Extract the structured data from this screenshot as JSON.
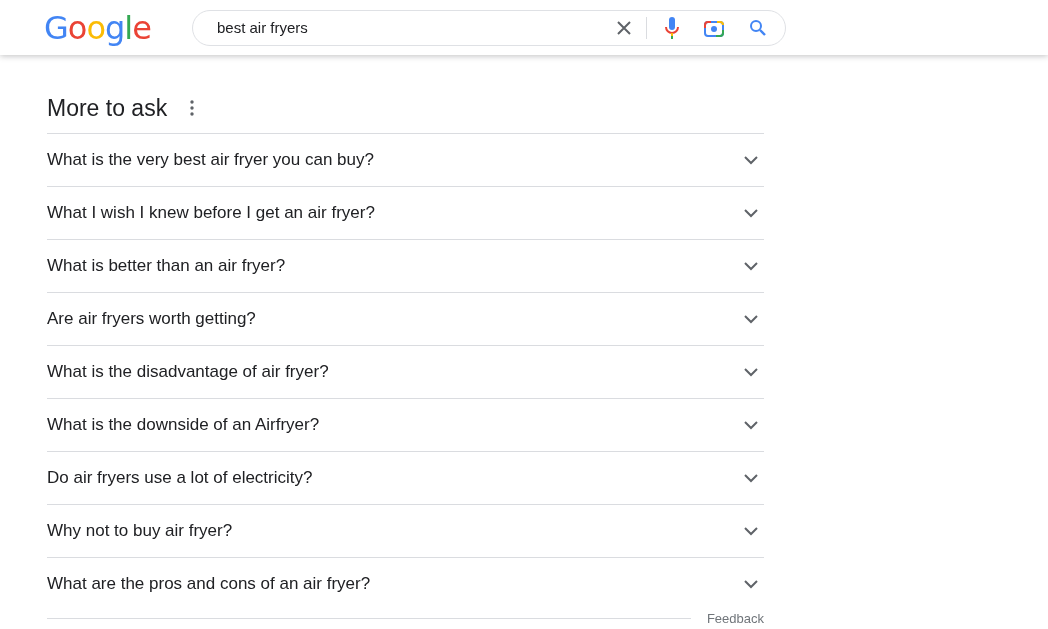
{
  "header": {
    "logo": "Google",
    "search": {
      "value": "best air fryers"
    }
  },
  "section": {
    "title": "More to ask",
    "questions": [
      {
        "text": "What is the very best air fryer you can buy?",
        "expanded": false
      },
      {
        "text": "What I wish I knew before I get an air fryer?",
        "expanded": false
      },
      {
        "text": "What is better than an air fryer?",
        "expanded": false
      },
      {
        "text": "Are air fryers worth getting?",
        "expanded": false
      },
      {
        "text": "What is the disadvantage of air fryer?",
        "expanded": false
      },
      {
        "text": "What is the downside of an Airfryer?",
        "expanded": false
      },
      {
        "text": "Do air fryers use a lot of electricity?",
        "expanded": false
      },
      {
        "text": "Why not to buy air fryer?",
        "expanded": false
      },
      {
        "text": "What are the pros and cons of an air fryer?",
        "expanded": false
      }
    ],
    "feedback": "Feedback"
  }
}
